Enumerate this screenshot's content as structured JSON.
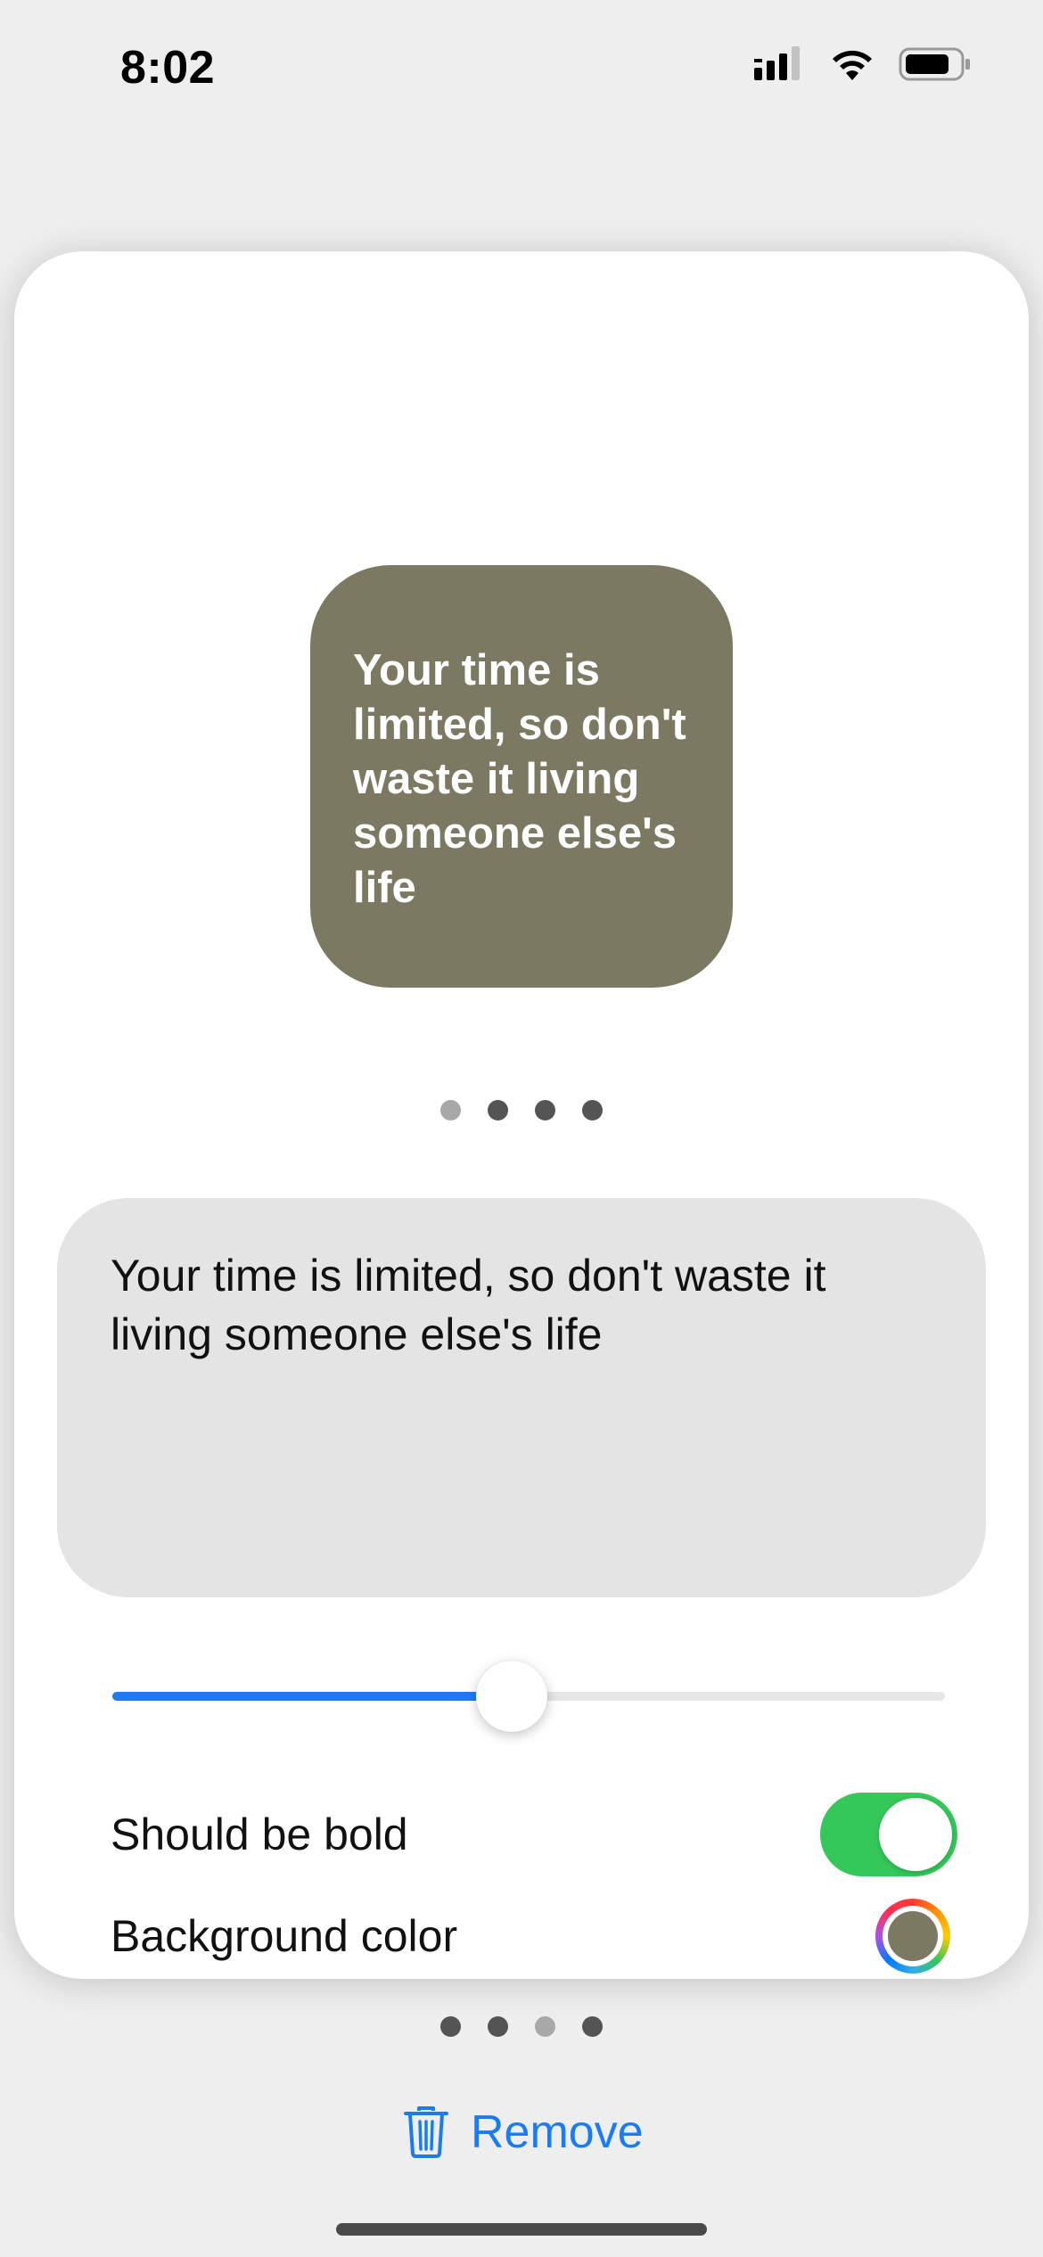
{
  "status_bar": {
    "time": "8:02",
    "icons": [
      "cellular-signal-icon",
      "wifi-icon",
      "battery-icon"
    ]
  },
  "widget_preview": {
    "text": "Your time is limited, so don't waste it living someone else's life",
    "background_color": "#7b7962",
    "text_color": "#ffffff"
  },
  "preview_page_indicator": {
    "count": 4,
    "current_index": 0
  },
  "editor": {
    "text": "Your time is limited, so don't waste it living someone else's life"
  },
  "font_size_slider": {
    "value_fraction": 0.48,
    "accent_color": "#1a7cf5"
  },
  "options": {
    "bold_label": "Should be bold",
    "bold_enabled": true,
    "background_label": "Background color",
    "background_color": "#7b7962"
  },
  "page_indicator": {
    "count": 4,
    "current_index": 2
  },
  "remove_button": {
    "label": "Remove",
    "icon": "trash-icon"
  }
}
